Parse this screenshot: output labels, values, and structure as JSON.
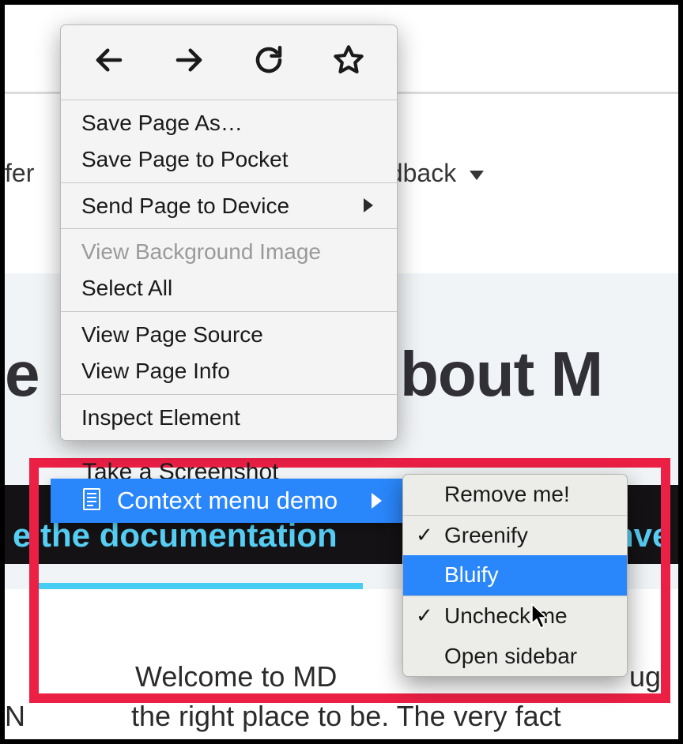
{
  "nav": {
    "left_fragment": "fer",
    "right_fragment": "edback"
  },
  "headline": {
    "left_fragment": "e",
    "right_fragment": "bout M"
  },
  "strip": {
    "left_text": "e the documentation",
    "right_text": "nve"
  },
  "body": {
    "line1_right": "Welcome to MD",
    "line1_far_right": "ug",
    "line2_left": "N",
    "line2_right": "the right place to be. The very fact"
  },
  "context_menu": {
    "groups": [
      {
        "items": [
          {
            "label": "Save Page As…",
            "disabled": false
          },
          {
            "label": "Save Page to Pocket",
            "disabled": false
          }
        ]
      },
      {
        "items": [
          {
            "label": "Send Page to Device",
            "disabled": false,
            "submenu": true
          }
        ]
      },
      {
        "items": [
          {
            "label": "View Background Image",
            "disabled": true
          },
          {
            "label": "Select All",
            "disabled": false
          }
        ]
      },
      {
        "items": [
          {
            "label": "View Page Source",
            "disabled": false
          },
          {
            "label": "View Page Info",
            "disabled": false
          }
        ]
      },
      {
        "items": [
          {
            "label": "Inspect Element",
            "disabled": false
          }
        ]
      }
    ],
    "screenshot_peek": "Take a Screenshot",
    "custom_item": {
      "label": "Context menu demo",
      "highlighted": true
    }
  },
  "submenu": {
    "items": [
      {
        "label": "Remove me!",
        "checked": false,
        "highlighted": false
      },
      null,
      {
        "label": "Greenify",
        "checked": true,
        "highlighted": false
      },
      {
        "label": "Bluify",
        "checked": false,
        "highlighted": true
      },
      null,
      {
        "label": "Uncheck me",
        "checked": true,
        "highlighted": false
      },
      {
        "label": "Open sidebar",
        "checked": false,
        "highlighted": false
      }
    ]
  }
}
